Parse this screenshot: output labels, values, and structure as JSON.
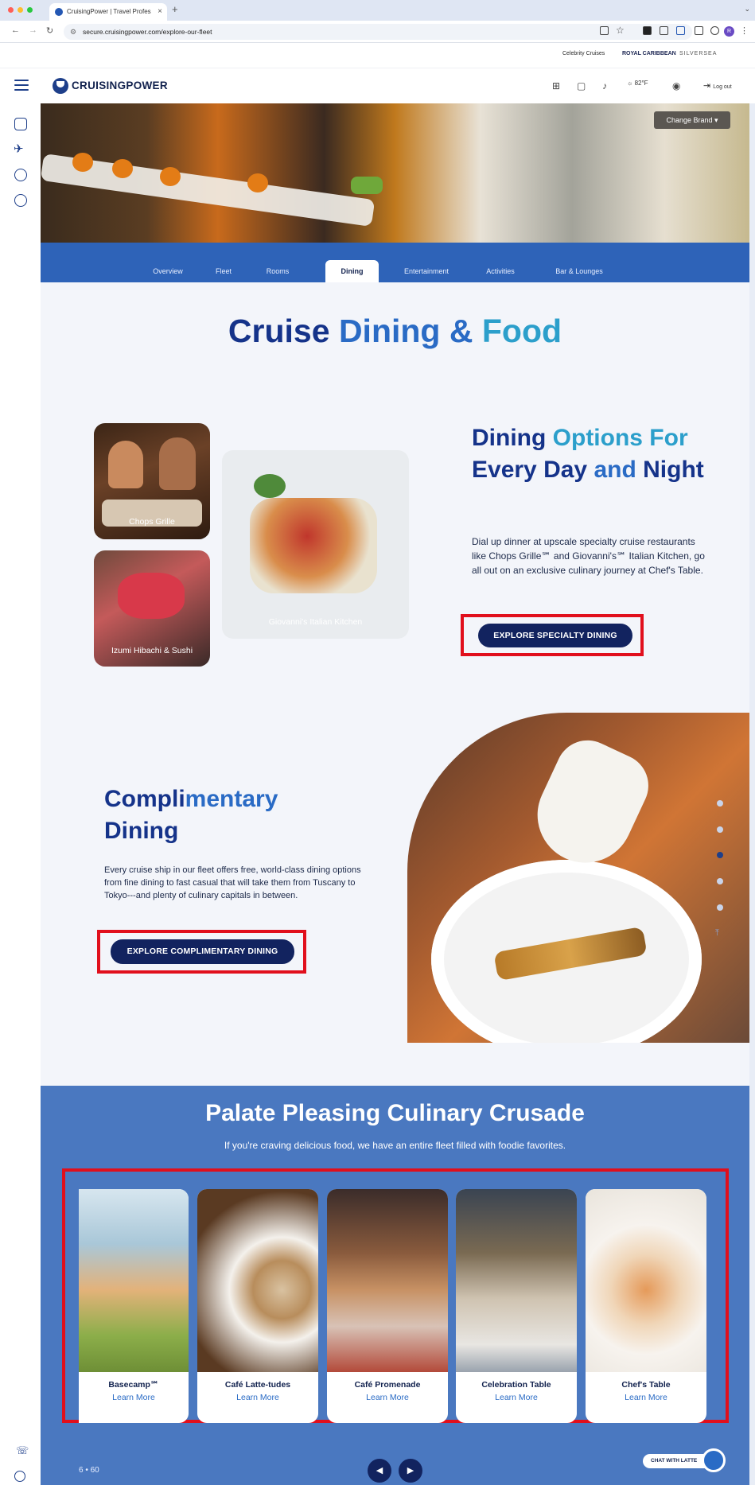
{
  "browser": {
    "tab_title": "CruisingPower | Travel Profes",
    "url": "secure.cruisingpower.com/explore-our-fleet",
    "profile_initial": "R"
  },
  "brand_strip": [
    "Celebrity Cruises",
    "ROYAL CARIBBEAN",
    "SILVERSEA"
  ],
  "header": {
    "logo_text": "CRUISINGPOWER",
    "weather": "82°F",
    "logout_label": "Log out"
  },
  "hero": {
    "change_brand_label": "Change Brand"
  },
  "nav_tabs": [
    {
      "label": "Overview",
      "active": false
    },
    {
      "label": "Fleet",
      "active": false
    },
    {
      "label": "Rooms",
      "active": false
    },
    {
      "label": "Dining",
      "active": true
    },
    {
      "label": "Entertainment",
      "active": false
    },
    {
      "label": "Activities",
      "active": false
    },
    {
      "label": "Bar & Lounges",
      "active": false
    }
  ],
  "main_title": {
    "part1": "Cruise",
    "part2": "Dining &",
    "part3": "Food"
  },
  "specialty": {
    "cards": [
      "Chops Grille",
      "Giovanni's Italian Kitchen",
      "Izumi Hibachi & Sushi"
    ],
    "title_parts": [
      "Dining",
      "Options For",
      "Every Day",
      "and",
      "Night"
    ],
    "description": "Dial up dinner at upscale specialty cruise restaurants like Chops Grille℠ and Giovanni's℠ Italian Kitchen, go all out on an exclusive culinary journey at Chef's Table.",
    "button_label": "EXPLORE SPECIALTY DINING"
  },
  "complimentary": {
    "title_parts": [
      "Compli",
      "mentary",
      "Dining"
    ],
    "description": "Every cruise ship in our fleet offers free, world-class dining options from fine dining to fast casual that will take them from Tuscany to Tokyo---and plenty of culinary capitals in between.",
    "button_label": "EXPLORE COMPLIMENTARY DINING"
  },
  "culinary": {
    "title": "Palate Pleasing Culinary Crusade",
    "subtitle": "If you're craving delicious food, we have an entire fleet filled with foodie favorites.",
    "cards": [
      {
        "name": "Basecamp℠",
        "link": "Learn More"
      },
      {
        "name": "Café Latte-tudes",
        "link": "Learn More"
      },
      {
        "name": "Café Promenade",
        "link": "Learn More"
      },
      {
        "name": "Celebration Table",
        "link": "Learn More"
      },
      {
        "name": "Chef's Table",
        "link": "Learn More"
      }
    ],
    "counter": "6 • 60",
    "prev_icon": "◀",
    "next_icon": "▶"
  },
  "chat_label": "CHAT WITH LATTE",
  "colors": {
    "navy": "#12235f",
    "accent_blue": "#2e63b8",
    "highlight_red": "#e10f1c"
  }
}
